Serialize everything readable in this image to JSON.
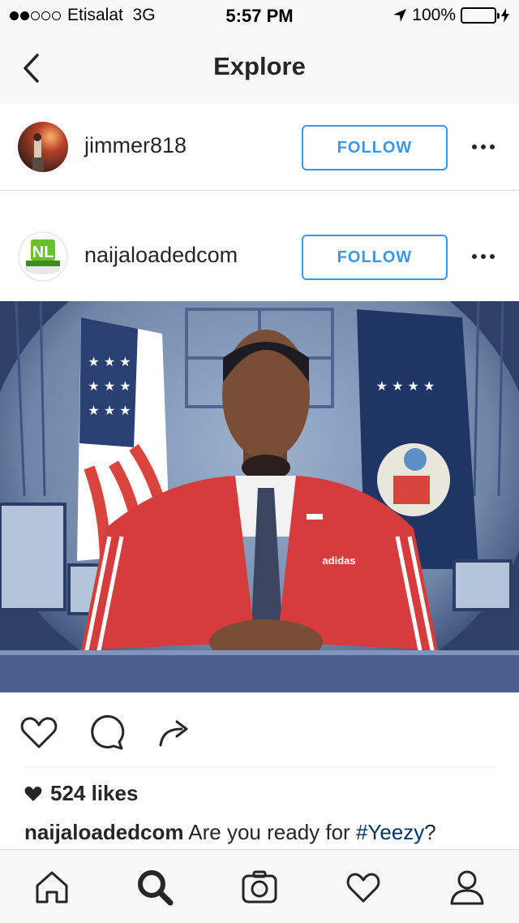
{
  "status_bar": {
    "carrier": "Etisalat",
    "network": "3G",
    "time": "5:57 PM",
    "battery": "100%",
    "signal_bars_filled": 2,
    "signal_bars_total": 5
  },
  "nav": {
    "title": "Explore",
    "back_icon": "chevron-left-icon"
  },
  "suggestions": [
    {
      "username": "jimmer818",
      "follow_label": "FOLLOW"
    },
    {
      "username": "naijaloadedcom",
      "follow_label": "FOLLOW"
    }
  ],
  "post": {
    "likes": "524 likes",
    "caption_user": "naijaloadedcom",
    "caption_text": " Are you ready for ",
    "hashtag": "#Yeezy",
    "caption_end": "?",
    "image_brand_text": "adidas"
  },
  "colors": {
    "accent_blue": "#3897f0",
    "hashtag": "#003569",
    "battery_green": "#4cd964"
  },
  "tab_bar": [
    "home-icon",
    "search-icon",
    "camera-icon",
    "heart-icon",
    "profile-icon"
  ]
}
